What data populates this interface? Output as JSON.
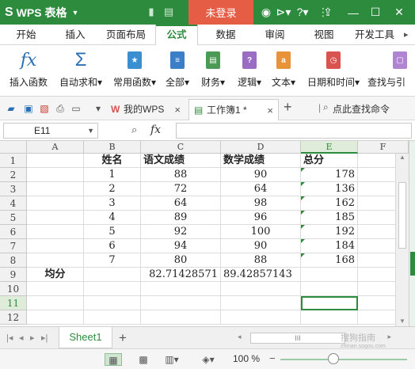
{
  "titlebar": {
    "app_name": "WPS 表格",
    "login_label": "未登录"
  },
  "menu": {
    "tabs": [
      "开始",
      "插入",
      "页面布局",
      "公式",
      "数据",
      "审阅",
      "视图",
      "开发工具"
    ],
    "active_index": 3
  },
  "ribbon": {
    "items": [
      {
        "label": "插入函数",
        "icon": "fx-icon"
      },
      {
        "label": "自动求和▾",
        "icon": "sigma-icon"
      },
      {
        "label": "常用函数▾",
        "icon": "star-doc-icon"
      },
      {
        "label": "全部▾",
        "icon": "list-doc-icon"
      },
      {
        "label": "财务▾",
        "icon": "finance-doc-icon"
      },
      {
        "label": "逻辑▾",
        "icon": "question-doc-icon"
      },
      {
        "label": "文本▾",
        "icon": "text-doc-icon"
      },
      {
        "label": "日期和时间▾",
        "icon": "clock-doc-icon"
      },
      {
        "label": "查找与引",
        "icon": "search-doc-icon"
      }
    ]
  },
  "doc_tabs": [
    {
      "label": "我的WPS",
      "active": false
    },
    {
      "label": "工作簿1 *",
      "active": true
    }
  ],
  "search_command": "点此查找命令",
  "formula_bar": {
    "name_box": "E11",
    "fx_label": "fx",
    "formula": ""
  },
  "grid": {
    "columns": [
      "A",
      "B",
      "C",
      "D",
      "E",
      "F"
    ],
    "rows": [
      "1",
      "2",
      "3",
      "4",
      "5",
      "6",
      "7",
      "8",
      "9",
      "10",
      "11",
      "12"
    ],
    "selected_cell": "E11",
    "cells": {
      "B1": "姓名",
      "C1": "语文成绩",
      "D1": "数学成绩",
      "E1": "总分",
      "B2": "1",
      "C2": "88",
      "D2": "90",
      "E2": "178",
      "B3": "2",
      "C3": "72",
      "D3": "64",
      "E3": "136",
      "B4": "3",
      "C4": "64",
      "D4": "98",
      "E4": "162",
      "B5": "4",
      "C5": "89",
      "D5": "96",
      "E5": "185",
      "B6": "5",
      "C6": "92",
      "D6": "100",
      "E6": "192",
      "B7": "6",
      "C7": "94",
      "D7": "90",
      "E7": "184",
      "B8": "7",
      "C8": "80",
      "D8": "88",
      "E8": "168",
      "A9": "均分",
      "C9": "82.71428571",
      "D9": "89.42857143"
    }
  },
  "sheet_tabs": [
    "Sheet1"
  ],
  "status": {
    "zoom": "100 %"
  },
  "watermark": {
    "line1": "搜狗指南",
    "line2": "zhinan.sogou.com"
  },
  "colors": {
    "brand_green": "#2d8b3e",
    "login_red": "#e55d45"
  }
}
